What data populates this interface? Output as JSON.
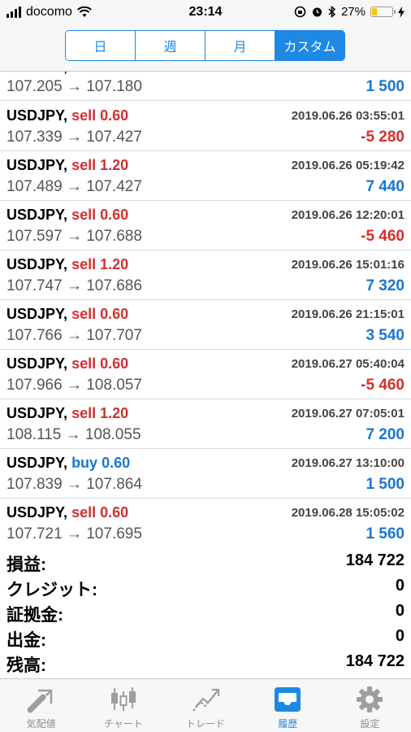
{
  "status_bar": {
    "carrier": "docomo",
    "time": "23:14",
    "battery_percent": "27%",
    "battery_level": 0.27
  },
  "segments": [
    {
      "label": "日",
      "active": false
    },
    {
      "label": "週",
      "active": false
    },
    {
      "label": "月",
      "active": false
    },
    {
      "label": "カスタム",
      "active": true
    }
  ],
  "partial_row": {
    "prices": "107.205 → 107.180",
    "profit": "1 500",
    "profit_sign": "pos"
  },
  "trades": [
    {
      "symbol": "USDJPY,",
      "side": "sell",
      "volume": "0.60",
      "time": "2019.06.26 03:55:01",
      "prices": "107.339 → 107.427",
      "profit": "-5 280",
      "profit_sign": "neg"
    },
    {
      "symbol": "USDJPY,",
      "side": "sell",
      "volume": "1.20",
      "time": "2019.06.26 05:19:42",
      "prices": "107.489 → 107.427",
      "profit": "7 440",
      "profit_sign": "pos"
    },
    {
      "symbol": "USDJPY,",
      "side": "sell",
      "volume": "0.60",
      "time": "2019.06.26 12:20:01",
      "prices": "107.597 → 107.688",
      "profit": "-5 460",
      "profit_sign": "neg"
    },
    {
      "symbol": "USDJPY,",
      "side": "sell",
      "volume": "1.20",
      "time": "2019.06.26 15:01:16",
      "prices": "107.747 → 107.686",
      "profit": "7 320",
      "profit_sign": "pos"
    },
    {
      "symbol": "USDJPY,",
      "side": "sell",
      "volume": "0.60",
      "time": "2019.06.26 21:15:01",
      "prices": "107.766 → 107.707",
      "profit": "3 540",
      "profit_sign": "pos"
    },
    {
      "symbol": "USDJPY,",
      "side": "sell",
      "volume": "0.60",
      "time": "2019.06.27 05:40:04",
      "prices": "107.966 → 108.057",
      "profit": "-5 460",
      "profit_sign": "neg"
    },
    {
      "symbol": "USDJPY,",
      "side": "sell",
      "volume": "1.20",
      "time": "2019.06.27 07:05:01",
      "prices": "108.115 → 108.055",
      "profit": "7 200",
      "profit_sign": "pos"
    },
    {
      "symbol": "USDJPY,",
      "side": "buy",
      "volume": "0.60",
      "time": "2019.06.27 13:10:00",
      "prices": "107.839 → 107.864",
      "profit": "1 500",
      "profit_sign": "pos"
    },
    {
      "symbol": "USDJPY,",
      "side": "sell",
      "volume": "0.60",
      "time": "2019.06.28 15:05:02",
      "prices": "107.721 → 107.695",
      "profit": "1 560",
      "profit_sign": "pos"
    }
  ],
  "summary": [
    {
      "label": "損益:",
      "value": "184 722"
    },
    {
      "label": "クレジット:",
      "value": "0"
    },
    {
      "label": "証拠金:",
      "value": "0"
    },
    {
      "label": "出金:",
      "value": "0"
    },
    {
      "label": "残高:",
      "value": "184 722"
    }
  ],
  "tabs": [
    {
      "label": "気配値",
      "icon": "quotes-arrow-icon",
      "active": false
    },
    {
      "label": "チャート",
      "icon": "candlestick-chart-icon",
      "active": false
    },
    {
      "label": "トレード",
      "icon": "trade-trend-icon",
      "active": false
    },
    {
      "label": "履歴",
      "icon": "history-inbox-icon",
      "active": true
    },
    {
      "label": "設定",
      "icon": "gear-icon",
      "active": false
    }
  ],
  "colors": {
    "accent": "#1e88e5",
    "sell": "#d32f2f",
    "buy": "#1976d2",
    "battery": "#f7c800"
  }
}
